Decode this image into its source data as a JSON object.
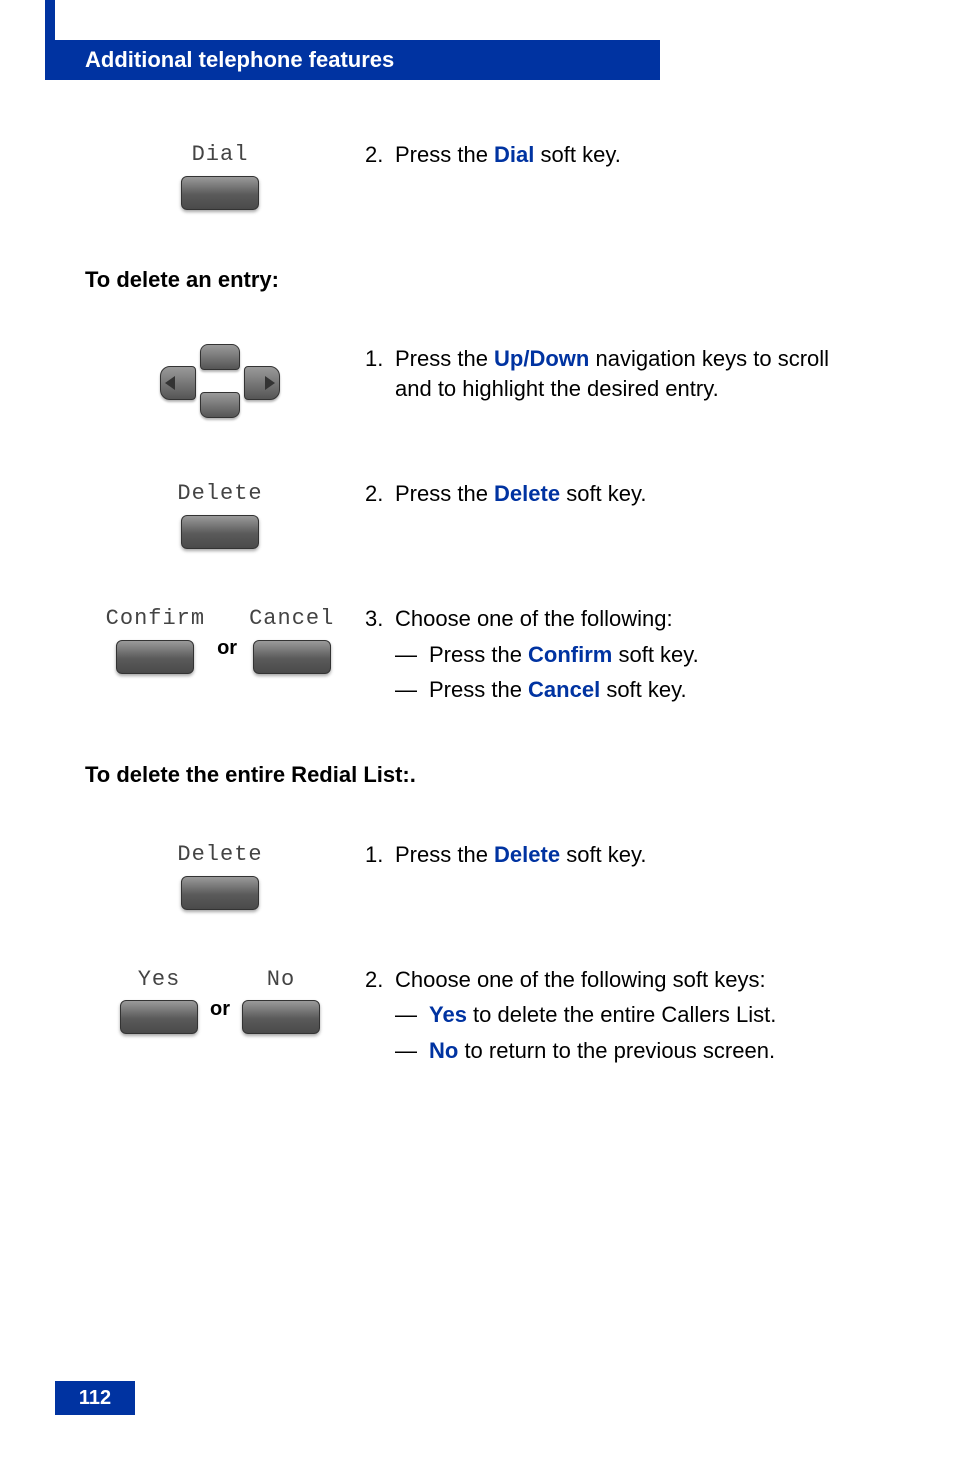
{
  "header": {
    "title": "Additional telephone features"
  },
  "page_number": "112",
  "or_label": "or",
  "softkeys": {
    "dial": "Dial",
    "delete": "Delete",
    "confirm": "Confirm",
    "cancel": "Cancel",
    "yes": "Yes",
    "no": "No"
  },
  "section1": {
    "step2": {
      "num": "2.",
      "pre": "Press the ",
      "key": "Dial",
      "post": " soft key."
    }
  },
  "heading_delete_entry": "To delete an entry:",
  "section2": {
    "step1": {
      "num": "1.",
      "pre": "Press the ",
      "key": "Up/Down",
      "post": " navigation keys to scroll and to highlight the desired entry."
    },
    "step2": {
      "num": "2.",
      "pre": "Press the ",
      "key": "Delete",
      "post": " soft key."
    },
    "step3": {
      "num": "3.",
      "intro": "Choose one of the following:",
      "a": {
        "pre": "Press the ",
        "key": "Confirm",
        "post": " soft key."
      },
      "b": {
        "pre": "Press the ",
        "key": "Cancel",
        "post": " soft key."
      }
    }
  },
  "heading_delete_list": "To delete the entire Redial List:.",
  "section3": {
    "step1": {
      "num": "1.",
      "pre": "Press the ",
      "key": "Delete",
      "post": " soft key."
    },
    "step2": {
      "num": "2.",
      "intro": "Choose one of the following soft keys:",
      "a": {
        "key": "Yes",
        "post": " to delete the entire Callers List."
      },
      "b": {
        "key": "No",
        "post": " to return to the previous screen."
      }
    }
  }
}
